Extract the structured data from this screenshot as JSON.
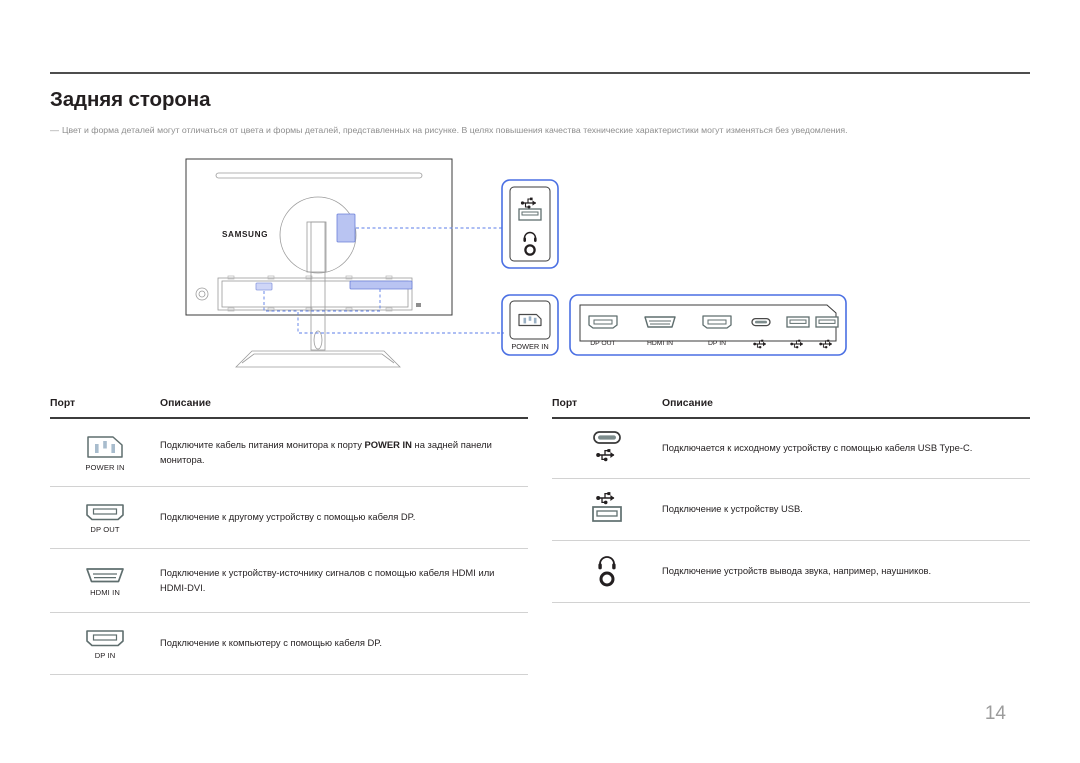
{
  "document": {
    "title": "Задняя сторона",
    "note_marker": "―",
    "note": "Цвет и форма деталей могут отличаться от цвета и формы деталей, представленных на рисунке. В целях повышения качества технические характеристики могут изменяться без уведомления.",
    "page_number": "14"
  },
  "illustration": {
    "brand": "SAMSUNG",
    "callouts": [
      {
        "name": "usb-headphone-callout",
        "labels": []
      },
      {
        "name": "power-in-callout",
        "labels": [
          "POWER IN"
        ]
      }
    ],
    "port_panel": {
      "labels": [
        "DP OUT",
        "HDMI IN",
        "DP IN",
        "usb-type-c-icon",
        "usb-icon",
        "usb-icon"
      ],
      "text_labels": [
        "DP OUT",
        "HDMI IN",
        "DP IN"
      ]
    },
    "power_callout_label": "POWER IN",
    "accent_color": "#4a6fe3",
    "highlight_fill": "#b9c4f2"
  },
  "tables": {
    "left": {
      "headers": {
        "port": "Порт",
        "description": "Описание"
      },
      "rows": [
        {
          "icon": "power-in-icon",
          "label": "POWER IN",
          "description_html": "Подключите кабель питания монитора к порту <b>POWER IN</b> на задней панели монитора.",
          "description_text": "Подключите кабель питания монитора к порту POWER IN на задней панели монитора."
        },
        {
          "icon": "dp-out-icon",
          "label": "DP OUT",
          "description_html": "Подключение к другому устройству с помощью кабеля DP.",
          "description_text": "Подключение к другому устройству с помощью кабеля DP."
        },
        {
          "icon": "hdmi-in-icon",
          "label": "HDMI IN",
          "description_html": "Подключение к устройству-источнику сигналов с помощью кабеля HDMI или HDMI-DVI.",
          "description_text": "Подключение к устройству-источнику сигналов с помощью кабеля HDMI или HDMI-DVI."
        },
        {
          "icon": "dp-in-icon",
          "label": "DP IN",
          "description_html": "Подключение к компьютеру с помощью кабеля DP.",
          "description_text": "Подключение к компьютеру с помощью кабеля DP."
        }
      ]
    },
    "right": {
      "headers": {
        "port": "Порт",
        "description": "Описание"
      },
      "rows": [
        {
          "icon": "usb-type-c-icon",
          "label": "",
          "description_html": "Подключается к исходному устройству с помощью кабеля USB Type-C.",
          "description_text": "Подключается к исходному устройству с помощью кабеля USB Type-C."
        },
        {
          "icon": "usb-a-icon",
          "label": "",
          "description_html": "Подключение к устройству USB.",
          "description_text": "Подключение к устройству USB."
        },
        {
          "icon": "headphone-jack-icon",
          "label": "",
          "description_html": "Подключение устройств вывода звука, например, наушников.",
          "description_text": "Подключение устройств вывода звука, например, наушников."
        }
      ]
    }
  }
}
